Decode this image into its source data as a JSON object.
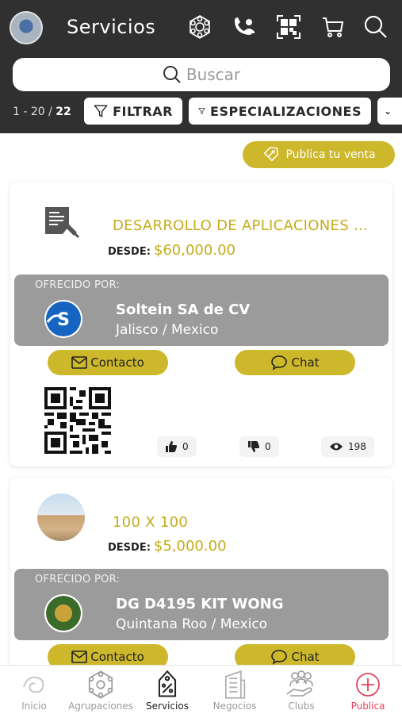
{
  "header": {
    "title": "Servicios",
    "search_placeholder": "Buscar",
    "count_range": "1 - 20 / ",
    "count_total": "22",
    "filter_label": "FILTRAR",
    "specializations_label": "ESPECIALIZACIONES",
    "icons": [
      "network-icon",
      "phone-user-icon",
      "qr-code-icon",
      "cart-icon",
      "search-icon"
    ]
  },
  "publish_sale_label": "Publica tu venta",
  "offered_by_label": "OFRECIDO POR:",
  "desde_label": "DESDE:",
  "contact_label": "Contacto",
  "chat_label": "Chat",
  "listings": [
    {
      "title": "DESARROLLO DE APLICACIONES ...",
      "price": "$60,000.00",
      "seller": "Soltein SA de CV",
      "location": "Jalisco / Mexico",
      "likes": "0",
      "dislikes": "0",
      "views": "198"
    },
    {
      "title": "100 X 100",
      "price": "$5,000.00",
      "seller": "DG D4195 KIT WONG",
      "location": "Quintana Roo / Mexico"
    }
  ],
  "nav": {
    "items": [
      "Inicio",
      "Agrupaciones",
      "Servicios",
      "Negocios",
      "Clubs",
      "Publica"
    ],
    "active": "Servicios",
    "accent": "#e8415a"
  },
  "colors": {
    "header": "#303030",
    "gold": "#cdb82c",
    "offer_bg": "#9b9b9b"
  }
}
